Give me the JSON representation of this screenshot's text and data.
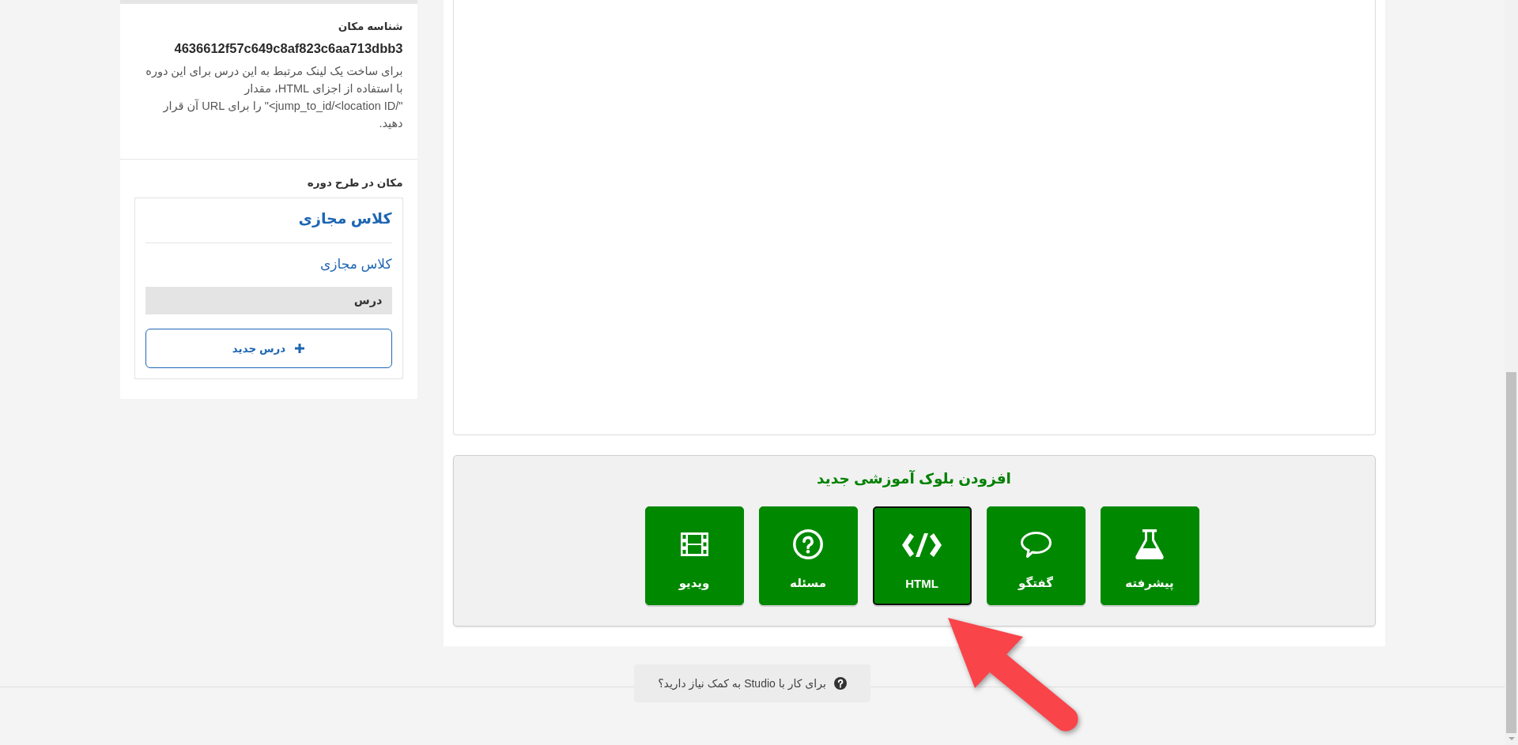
{
  "sidebar": {
    "location_id": {
      "label": "شناسه مکان",
      "value": "4636612f57c649c8af823c6aa713dbb3",
      "help": "برای ساخت یک لینک مرتبط به این درس برای این دوره با استفاده از اجزای HTML، مقدار \"/jump_to_id/<location ID>\" را برای URL آن قرار دهید."
    },
    "outline": {
      "label": "مکان در طرح دوره",
      "section": "کلاس مجازی",
      "subsection": "کلاس مجازی",
      "units": [
        {
          "label": "درس",
          "selected": true
        }
      ],
      "new_unit_button": "درس جدید"
    }
  },
  "add_component": {
    "title": "افزودن بلوک آموزشی جدید",
    "buttons": [
      {
        "label": "پیشرفته",
        "kind": "advanced",
        "selected": false
      },
      {
        "label": "گفتگو",
        "kind": "discussion",
        "selected": false
      },
      {
        "label": "HTML",
        "kind": "html",
        "selected": true
      },
      {
        "label": "مسئله",
        "kind": "problem",
        "selected": false
      },
      {
        "label": "ویدیو",
        "kind": "video",
        "selected": false
      }
    ]
  },
  "help": {
    "text": "برای کار با Studio به کمک نیاز دارید؟"
  }
}
